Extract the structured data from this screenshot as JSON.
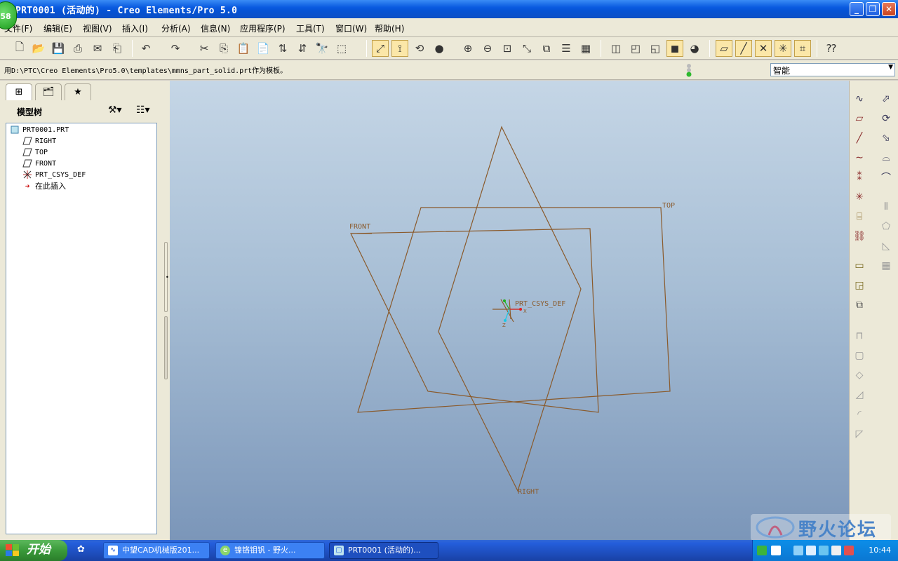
{
  "window": {
    "title": "PRT0001 (活动的) - Creo Elements/Pro 5.0",
    "badge": "58",
    "minimize": "_",
    "maximize": "❐",
    "close": "✕"
  },
  "menu": [
    "文件(F)",
    "编辑(E)",
    "视图(V)",
    "插入(I)",
    "分析(A)",
    "信息(N)",
    "应用程序(P)",
    "工具(T)",
    "窗口(W)",
    "帮助(H)"
  ],
  "message": "用D:\\PTC\\Creo Elements\\Pro5.0\\templates\\mmns_part_solid.prt作为模板。",
  "filter": {
    "value": "智能"
  },
  "panel": {
    "title": "模型树",
    "tree": [
      {
        "label": "PRT0001.PRT",
        "icon": "part-icon"
      },
      {
        "label": "RIGHT",
        "icon": "datum-plane-icon"
      },
      {
        "label": "TOP",
        "icon": "datum-plane-icon"
      },
      {
        "label": "FRONT",
        "icon": "datum-plane-icon"
      },
      {
        "label": "PRT_CSYS_DEF",
        "icon": "csys-icon"
      },
      {
        "label": "在此插入",
        "icon": "insert-here-arrow-icon"
      }
    ]
  },
  "graphics": {
    "labels": {
      "front": "FRONT",
      "top": "TOP",
      "right": "RIGHT",
      "csys": "PRT_CSYS_DEF",
      "axis_x": "X",
      "axis_z": "Z"
    },
    "line_color": "#8a5a2b"
  },
  "watermark": {
    "text": "野火论坛"
  },
  "taskbar": {
    "start": "开始",
    "tasks": [
      {
        "label": "中望CAD机械版201...",
        "active": false
      },
      {
        "label": "镍铬钼钒 - 野火...",
        "active": false
      },
      {
        "label": "PRT0001 (活动的)...",
        "active": true
      }
    ],
    "clock": "10:44"
  }
}
